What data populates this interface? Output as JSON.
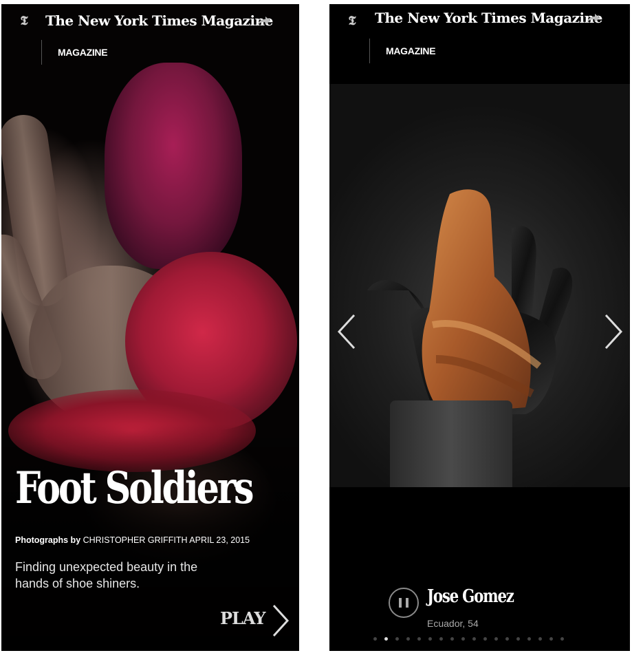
{
  "left_screen": {
    "header": {
      "brand": "The New York Times Magazine",
      "section": "MAGAZINE"
    },
    "article": {
      "headline": "Foot Soldiers",
      "byline_prefix": "Photographs by",
      "byline_author": "CHRISTOPHER GRIFFITH",
      "byline_date": "APRIL 23, 2015",
      "dek": "Finding unexpected beauty in the hands of shoe shiners.",
      "play_label": "PLAY"
    }
  },
  "right_screen": {
    "header": {
      "brand": "The New York Times Magazine",
      "section": "MAGAZINE"
    },
    "slide": {
      "name": "Jose Gomez",
      "meta": "Ecuador, 54"
    },
    "pager": {
      "total": 18,
      "active_index": 1
    }
  },
  "colors": {
    "background": "#000000",
    "text": "#ffffff",
    "muted": "#aaaaaa"
  }
}
